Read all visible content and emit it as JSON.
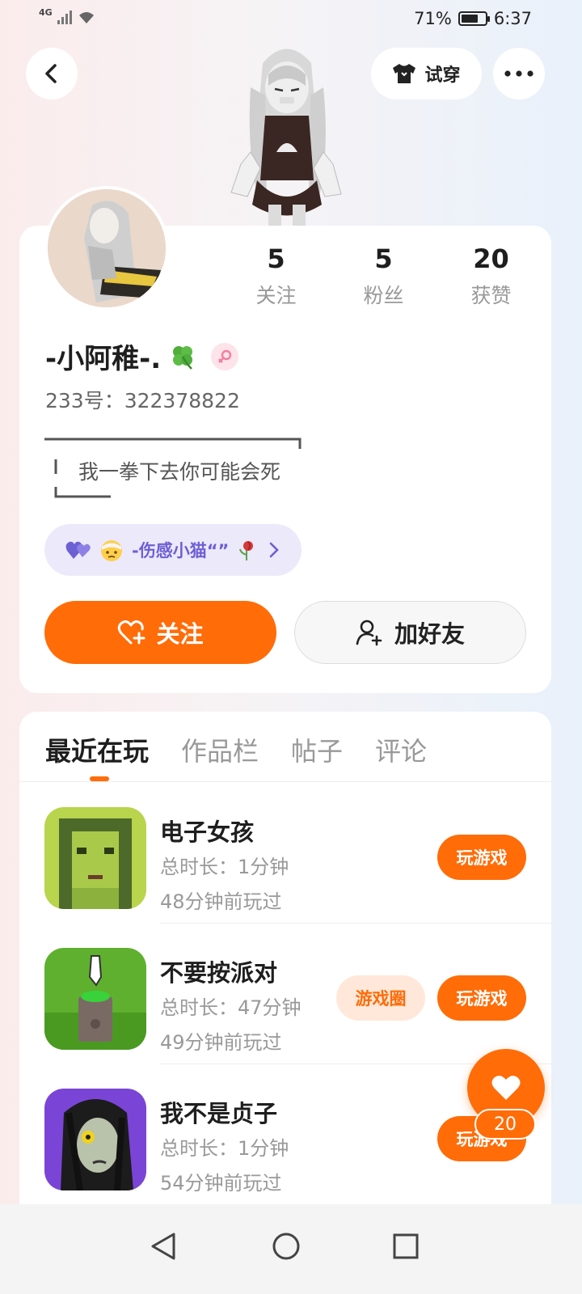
{
  "status": {
    "network": "4G",
    "battery_percent": "71%",
    "battery_level": 0.71,
    "time": "6:37"
  },
  "header": {
    "tryon_label": "试穿"
  },
  "profile": {
    "stats": [
      {
        "num": "5",
        "label": "关注"
      },
      {
        "num": "5",
        "label": "粉丝"
      },
      {
        "num": "20",
        "label": "获赞"
      }
    ],
    "username": "-小阿稚-.",
    "uid": "233号：322378822",
    "bio": "我一拳下去你可能会死",
    "group_label": "-伤感小猫“”",
    "follow_label": "关注",
    "add_friend_label": "加好友"
  },
  "tabs": [
    "最近在玩",
    "作品栏",
    "帖子",
    "评论"
  ],
  "games": [
    {
      "title": "电子女孩",
      "duration": "总时长：1分钟",
      "last_played": "48分钟前玩过",
      "play_label": "玩游戏"
    },
    {
      "title": "不要按派对",
      "duration": "总时长：47分钟",
      "last_played": "49分钟前玩过",
      "circle_label": "游戏圈",
      "play_label": "玩游戏"
    },
    {
      "title": "我不是贞子",
      "duration": "总时长：1分钟",
      "last_played": "54分钟前玩过",
      "play_label": "玩游戏"
    }
  ],
  "floating_like": {
    "count": "20"
  },
  "colors": {
    "accent": "#ff6c08",
    "group_purple": "#6d5fd4"
  }
}
